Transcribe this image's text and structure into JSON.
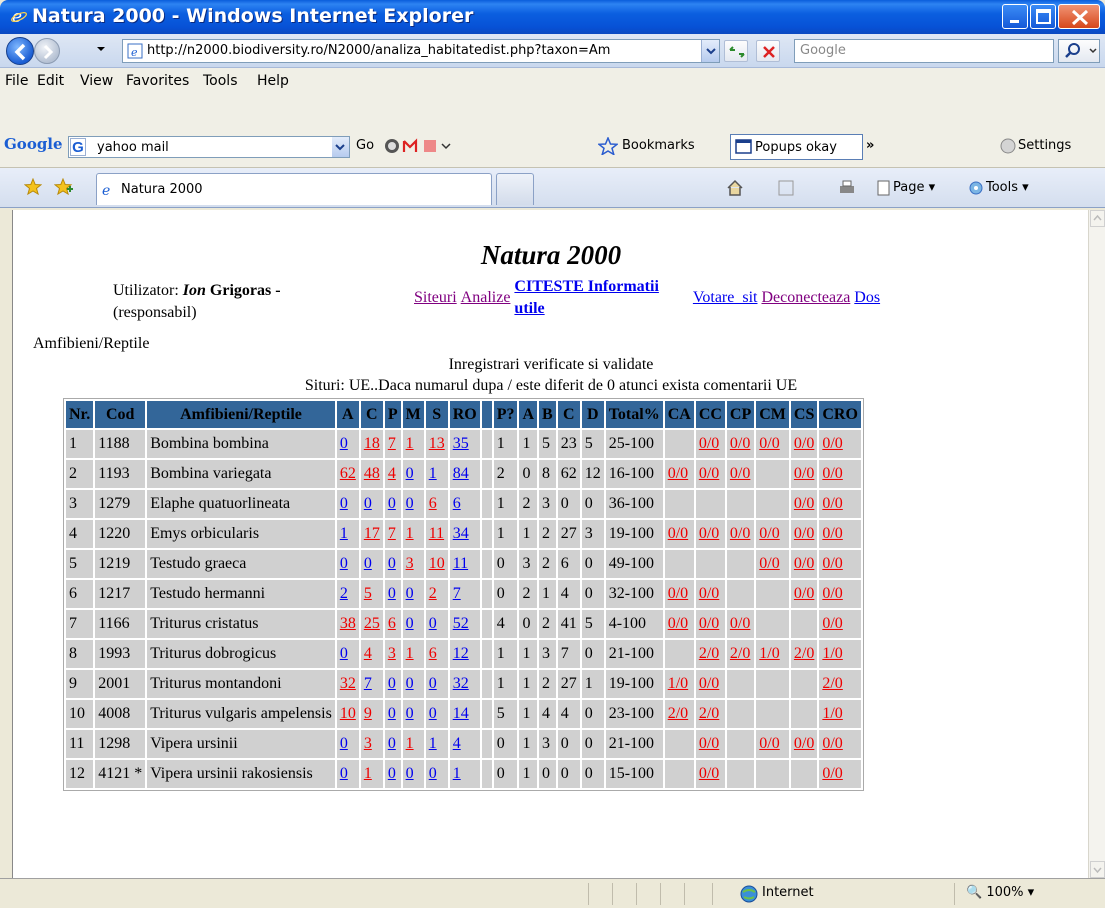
{
  "window": {
    "title": "Natura 2000 - Windows Internet Explorer"
  },
  "address": {
    "url": "http://n2000.biodiversity.ro/N2000/analiza_habitatedist.php?taxon=Am",
    "search_placeholder": "Google"
  },
  "menu": [
    "File",
    "Edit",
    "View",
    "Favorites",
    "Tools",
    "Help"
  ],
  "google_toolbar": {
    "logo": "Google",
    "query": "yahoo mail",
    "go": "Go",
    "bookmarks": "Bookmarks",
    "popups": "Popups okay",
    "more": "»",
    "settings": "Settings"
  },
  "tabs": {
    "active_label": "Natura 2000",
    "page": "Page",
    "tools": "Tools"
  },
  "page": {
    "heading": "Natura 2000",
    "user_prefix": "Utilizator: ",
    "user_first": "Ion",
    "user_last": " Grigoras -",
    "user_role": "(responsabil)",
    "links": {
      "siteuri": "Siteuri",
      "analize": "Analize",
      "citeste_1": "CITESTE Informatii",
      "citeste_2": "utile",
      "votare": "Votare  sit",
      "deconecteaza": "Deconecteaza",
      "dos": "Dos"
    },
    "group": "Amfibieni/Reptile",
    "subtitle1": "Inregistrari verificate si validate",
    "subtitle2": "Situri: UE..Daca numarul dupa / este diferit de 0 atunci exista comentarii UE"
  },
  "table": {
    "headers": [
      "Nr.",
      "Cod",
      "Amfibieni/Reptile",
      "A",
      "C",
      "P",
      "M",
      "S",
      "RO",
      "",
      "P?",
      "A",
      "B",
      "C",
      "D",
      "Total%",
      "CA",
      "CC",
      "CP",
      "CM",
      "CS",
      "CRO"
    ],
    "rows": [
      {
        "nr": "1",
        "cod": "1188",
        "name": "Bombina bombina",
        "A": [
          "0",
          "b"
        ],
        "C": [
          "18",
          "r"
        ],
        "P": [
          "7",
          "r"
        ],
        "M": [
          "1",
          "r"
        ],
        "S": [
          "13",
          "r"
        ],
        "RO": [
          "35",
          "b"
        ],
        "Pq": "1",
        "a": "1",
        "b": "5",
        "c": "23",
        "d": "5",
        "total": "25-100",
        "CA": "",
        "CC": "0/0",
        "CP": "0/0",
        "CM": "0/0",
        "CS": "0/0",
        "CRO": "0/0"
      },
      {
        "nr": "2",
        "cod": "1193",
        "name": "Bombina variegata",
        "A": [
          "62",
          "r"
        ],
        "C": [
          "48",
          "r"
        ],
        "P": [
          "4",
          "r"
        ],
        "M": [
          "0",
          "b"
        ],
        "S": [
          "1",
          "b"
        ],
        "RO": [
          "84",
          "b"
        ],
        "Pq": "2",
        "a": "0",
        "b": "8",
        "c": "62",
        "d": "12",
        "total": "16-100",
        "CA": "0/0",
        "CC": "0/0",
        "CP": "0/0",
        "CM": "",
        "CS": "0/0",
        "CRO": "0/0"
      },
      {
        "nr": "3",
        "cod": "1279",
        "name": "Elaphe quatuorlineata",
        "A": [
          "0",
          "b"
        ],
        "C": [
          "0",
          "b"
        ],
        "P": [
          "0",
          "b"
        ],
        "M": [
          "0",
          "b"
        ],
        "S": [
          "6",
          "r"
        ],
        "RO": [
          "6",
          "b"
        ],
        "Pq": "1",
        "a": "2",
        "b": "3",
        "c": "0",
        "d": "0",
        "total": "36-100",
        "CA": "",
        "CC": "",
        "CP": "",
        "CM": "",
        "CS": "0/0",
        "CRO": "0/0"
      },
      {
        "nr": "4",
        "cod": "1220",
        "name": "Emys orbicularis",
        "A": [
          "1",
          "b"
        ],
        "C": [
          "17",
          "r"
        ],
        "P": [
          "7",
          "r"
        ],
        "M": [
          "1",
          "r"
        ],
        "S": [
          "11",
          "r"
        ],
        "RO": [
          "34",
          "b"
        ],
        "Pq": "1",
        "a": "1",
        "b": "2",
        "c": "27",
        "d": "3",
        "total": "19-100",
        "CA": "0/0",
        "CC": "0/0",
        "CP": "0/0",
        "CM": "0/0",
        "CS": "0/0",
        "CRO": "0/0"
      },
      {
        "nr": "5",
        "cod": "1219",
        "name": "Testudo graeca",
        "A": [
          "0",
          "b"
        ],
        "C": [
          "0",
          "b"
        ],
        "P": [
          "0",
          "b"
        ],
        "M": [
          "3",
          "r"
        ],
        "S": [
          "10",
          "r"
        ],
        "RO": [
          "11",
          "b"
        ],
        "Pq": "0",
        "a": "3",
        "b": "2",
        "c": "6",
        "d": "0",
        "total": "49-100",
        "CA": "",
        "CC": "",
        "CP": "",
        "CM": "0/0",
        "CS": "0/0",
        "CRO": "0/0"
      },
      {
        "nr": "6",
        "cod": "1217",
        "name": "Testudo hermanni",
        "A": [
          "2",
          "b"
        ],
        "C": [
          "5",
          "r"
        ],
        "P": [
          "0",
          "b"
        ],
        "M": [
          "0",
          "b"
        ],
        "S": [
          "2",
          "r"
        ],
        "RO": [
          "7",
          "b"
        ],
        "Pq": "0",
        "a": "2",
        "b": "1",
        "c": "4",
        "d": "0",
        "total": "32-100",
        "CA": "0/0",
        "CC": "0/0",
        "CP": "",
        "CM": "",
        "CS": "0/0",
        "CRO": "0/0"
      },
      {
        "nr": "7",
        "cod": "1166",
        "name": "Triturus cristatus",
        "A": [
          "38",
          "r"
        ],
        "C": [
          "25",
          "r"
        ],
        "P": [
          "6",
          "r"
        ],
        "M": [
          "0",
          "b"
        ],
        "S": [
          "0",
          "b"
        ],
        "RO": [
          "52",
          "b"
        ],
        "Pq": "4",
        "a": "0",
        "b": "2",
        "c": "41",
        "d": "5",
        "total": "4-100",
        "CA": "0/0",
        "CC": "0/0",
        "CP": "0/0",
        "CM": "",
        "CS": "",
        "CRO": "0/0"
      },
      {
        "nr": "8",
        "cod": "1993",
        "name": "Triturus dobrogicus",
        "A": [
          "0",
          "b"
        ],
        "C": [
          "4",
          "r"
        ],
        "P": [
          "3",
          "r"
        ],
        "M": [
          "1",
          "r"
        ],
        "S": [
          "6",
          "r"
        ],
        "RO": [
          "12",
          "b"
        ],
        "Pq": "1",
        "a": "1",
        "b": "3",
        "c": "7",
        "d": "0",
        "total": "21-100",
        "CA": "",
        "CC": "2/0",
        "CP": "2/0",
        "CM": "1/0",
        "CS": "2/0",
        "CRO": "1/0"
      },
      {
        "nr": "9",
        "cod": "2001",
        "name": "Triturus montandoni",
        "A": [
          "32",
          "r"
        ],
        "C": [
          "7",
          "b"
        ],
        "P": [
          "0",
          "b"
        ],
        "M": [
          "0",
          "b"
        ],
        "S": [
          "0",
          "b"
        ],
        "RO": [
          "32",
          "b"
        ],
        "Pq": "1",
        "a": "1",
        "b": "2",
        "c": "27",
        "d": "1",
        "total": "19-100",
        "CA": "1/0",
        "CC": "0/0",
        "CP": "",
        "CM": "",
        "CS": "",
        "CRO": "2/0"
      },
      {
        "nr": "10",
        "cod": "4008",
        "name": "Triturus vulgaris ampelensis",
        "A": [
          "10",
          "r"
        ],
        "C": [
          "9",
          "r"
        ],
        "P": [
          "0",
          "b"
        ],
        "M": [
          "0",
          "b"
        ],
        "S": [
          "0",
          "b"
        ],
        "RO": [
          "14",
          "b"
        ],
        "Pq": "5",
        "a": "1",
        "b": "4",
        "c": "4",
        "d": "0",
        "total": "23-100",
        "CA": "2/0",
        "CC": "2/0",
        "CP": "",
        "CM": "",
        "CS": "",
        "CRO": "1/0"
      },
      {
        "nr": "11",
        "cod": "1298",
        "name": "Vipera ursinii",
        "A": [
          "0",
          "b"
        ],
        "C": [
          "3",
          "r"
        ],
        "P": [
          "0",
          "b"
        ],
        "M": [
          "1",
          "r"
        ],
        "S": [
          "1",
          "b"
        ],
        "RO": [
          "4",
          "b"
        ],
        "Pq": "0",
        "a": "1",
        "b": "3",
        "c": "0",
        "d": "0",
        "total": "21-100",
        "CA": "",
        "CC": "0/0",
        "CP": "",
        "CM": "0/0",
        "CS": "0/0",
        "CRO": "0/0"
      },
      {
        "nr": "12",
        "cod": "4121 *",
        "name": "Vipera ursinii rakosiensis",
        "A": [
          "0",
          "b"
        ],
        "C": [
          "1",
          "r"
        ],
        "P": [
          "0",
          "b"
        ],
        "M": [
          "0",
          "b"
        ],
        "S": [
          "0",
          "b"
        ],
        "RO": [
          "1",
          "b"
        ],
        "Pq": "0",
        "a": "1",
        "b": "0",
        "c": "0",
        "d": "0",
        "total": "15-100",
        "CA": "",
        "CC": "0/0",
        "CP": "",
        "CM": "",
        "CS": "",
        "CRO": "0/0"
      }
    ]
  },
  "status": {
    "zone": "Internet",
    "zoom": "100%"
  }
}
